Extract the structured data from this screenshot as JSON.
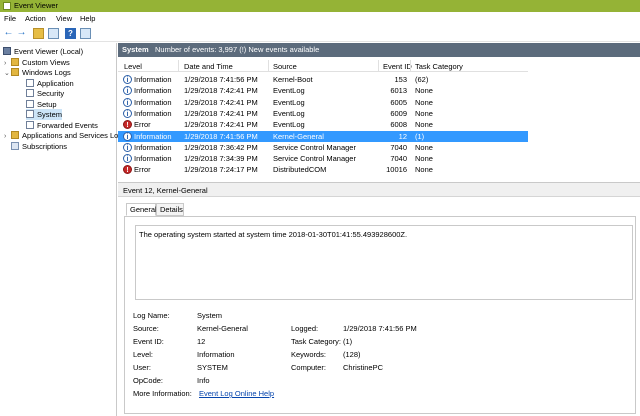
{
  "window": {
    "title": "Event Viewer"
  },
  "menu": [
    "File",
    "Action",
    "View",
    "Help"
  ],
  "tree": [
    {
      "label": "Event Viewer (Local)",
      "type": "ev",
      "level": 0,
      "chev": ""
    },
    {
      "label": "Custom Views",
      "type": "fold",
      "level": 1,
      "chev": "›"
    },
    {
      "label": "Windows Logs",
      "type": "fold",
      "level": 1,
      "chev": "⌄"
    },
    {
      "label": "Application",
      "type": "log",
      "level": 2,
      "chev": ""
    },
    {
      "label": "Security",
      "type": "log",
      "level": 2,
      "chev": ""
    },
    {
      "label": "Setup",
      "type": "log",
      "level": 2,
      "chev": ""
    },
    {
      "label": "System",
      "type": "log",
      "level": 2,
      "chev": "",
      "selected": true
    },
    {
      "label": "Forwarded Events",
      "type": "log",
      "level": 2,
      "chev": ""
    },
    {
      "label": "Applications and Services Lo",
      "type": "fold",
      "level": 1,
      "chev": "›"
    },
    {
      "label": "Subscriptions",
      "type": "sub",
      "level": 1,
      "chev": ""
    }
  ],
  "header": {
    "log_name": "System",
    "count": "Number of events: 3,997 (!) New events available"
  },
  "columns": [
    "Level",
    "Date and Time",
    "Source",
    "Event ID",
    "Task Category"
  ],
  "events": [
    {
      "level": "Information",
      "kind": "info",
      "datetime": "1/29/2018 7:41:56 PM",
      "source": "Kernel-Boot",
      "id": "153",
      "task": "(62)"
    },
    {
      "level": "Information",
      "kind": "info",
      "datetime": "1/29/2018 7:42:41 PM",
      "source": "EventLog",
      "id": "6013",
      "task": "None"
    },
    {
      "level": "Information",
      "kind": "info",
      "datetime": "1/29/2018 7:42:41 PM",
      "source": "EventLog",
      "id": "6005",
      "task": "None"
    },
    {
      "level": "Information",
      "kind": "info",
      "datetime": "1/29/2018 7:42:41 PM",
      "source": "EventLog",
      "id": "6009",
      "task": "None"
    },
    {
      "level": "Error",
      "kind": "err",
      "datetime": "1/29/2018 7:42:41 PM",
      "source": "EventLog",
      "id": "6008",
      "task": "None"
    },
    {
      "level": "Information",
      "kind": "info",
      "datetime": "1/29/2018 7:41:56 PM",
      "source": "Kernel-General",
      "id": "12",
      "task": "(1)",
      "selected": true
    },
    {
      "level": "Information",
      "kind": "info",
      "datetime": "1/29/2018 7:36:42 PM",
      "source": "Service Control Manager",
      "id": "7040",
      "task": "None"
    },
    {
      "level": "Information",
      "kind": "info",
      "datetime": "1/29/2018 7:34:39 PM",
      "source": "Service Control Manager",
      "id": "7040",
      "task": "None"
    },
    {
      "level": "Error",
      "kind": "err",
      "datetime": "1/29/2018 7:24:17 PM",
      "source": "DistributedCOM",
      "id": "10016",
      "task": "None"
    }
  ],
  "detail": {
    "heading": "Event 12, Kernel-General",
    "tabs": [
      "General",
      "Details"
    ],
    "message": "The operating system started at system time 2018-01-30T01:41:55.493928600Z.",
    "labels": {
      "log_name": "Log Name:",
      "source": "Source:",
      "event_id": "Event ID:",
      "level": "Level:",
      "user": "User:",
      "opcode": "OpCode:",
      "more_info": "More Information:",
      "logged": "Logged:",
      "task_category": "Task Category:",
      "keywords": "Keywords:",
      "computer": "Computer:"
    },
    "values": {
      "log_name": "System",
      "source": "Kernel-General",
      "event_id": "12",
      "level": "Information",
      "user": "SYSTEM",
      "opcode": "Info",
      "more_info": "Event Log Online Help",
      "logged": "1/29/2018 7:41:56 PM",
      "task_category": "(1)",
      "keywords": "(128)",
      "computer": "ChristinePC"
    }
  },
  "icons": {
    "info": "i",
    "err": "!"
  }
}
